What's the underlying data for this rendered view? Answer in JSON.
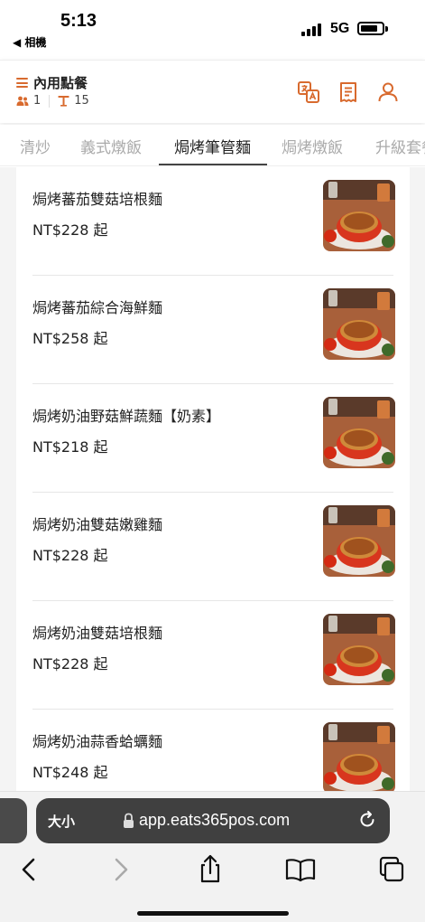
{
  "status_bar": {
    "time": "5:13",
    "back_app": "◀ 相機",
    "network": "5G"
  },
  "header": {
    "title": "內用點餐",
    "guests": "1",
    "table": "15",
    "icons": [
      "hamburger-icon",
      "translate-icon",
      "receipt-icon",
      "person-icon"
    ],
    "accent_color": "#d86a2e"
  },
  "tabs": {
    "items": [
      "清炒",
      "義式燉飯",
      "焗烤筆管麵",
      "焗烤燉飯",
      "升級套餐"
    ],
    "active_index": 2
  },
  "menu": {
    "items": [
      {
        "name": "焗烤蕃茄雙菇培根麵",
        "price": "NT$228 起"
      },
      {
        "name": "焗烤蕃茄綜合海鮮麵",
        "price": "NT$258 起"
      },
      {
        "name": "焗烤奶油野菇鮮蔬麵【奶素】",
        "price": "NT$218 起"
      },
      {
        "name": "焗烤奶油雙菇嫩雞麵",
        "price": "NT$228 起"
      },
      {
        "name": "焗烤奶油雙菇培根麵",
        "price": "NT$228 起"
      },
      {
        "name": "焗烤奶油蒜香蛤蠣麵",
        "price": "NT$248 起"
      }
    ]
  },
  "browser": {
    "size_label": "大小",
    "url": "app.eats365pos.com"
  }
}
